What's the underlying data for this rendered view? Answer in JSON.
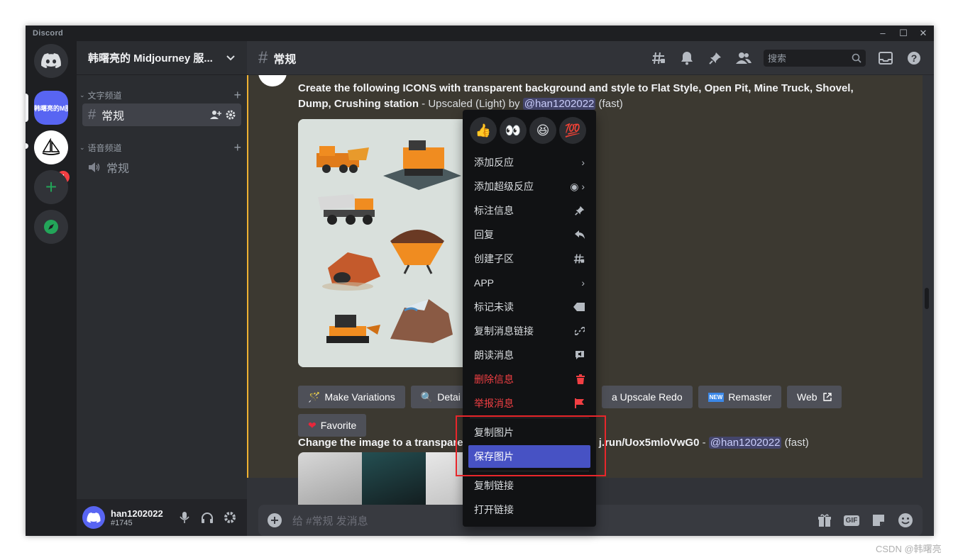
{
  "window": {
    "app_name": "Discord",
    "minimize": "–",
    "maximize": "☐",
    "close": "✕"
  },
  "servers": {
    "home_icon": "discord-logo-icon",
    "active_server_label": "韩曙亮的M服务",
    "midjourney_badge": "1",
    "add_server": "+",
    "explore": "compass-icon"
  },
  "guild": {
    "name": "韩曙亮的 Midjourney 服...",
    "chevron": "⌄"
  },
  "categories": {
    "text": "文字频道",
    "voice": "语音频道"
  },
  "channels": {
    "text_channel": "常规",
    "voice_channel": "常规"
  },
  "user": {
    "name": "han1202022",
    "tag": "#1745"
  },
  "header": {
    "channel_name": "常规",
    "search_placeholder": "搜索"
  },
  "message1": {
    "prompt": "Create the following ICONS with transparent background and style to Flat Style, Open Pit, Mine Truck, Shovel, Dump, Crushing station",
    "suffix": " - Upscaled (Light) by ",
    "mention": "@han1202022",
    "speed": " (fast)"
  },
  "buttons": {
    "make_variations": "Make Variations",
    "detail": "Detai",
    "upscale_redo": "a Upscale Redo",
    "remaster": "Remaster",
    "web": "Web",
    "favorite": "Favorite"
  },
  "message2": {
    "prefix": "Change the image to a transparen",
    "link": "j.run/Uox5mloVwG0",
    "dash": " - ",
    "mention": "@han1202022",
    "speed": " (fast)"
  },
  "composer": {
    "placeholder": "给 #常规 发消息"
  },
  "context_menu": {
    "reactions": [
      "👍",
      "👀",
      "😆",
      "💯"
    ],
    "items": [
      {
        "label": "添加反应",
        "icon": "chevron-right-icon"
      },
      {
        "label": "添加超级反应",
        "icon": "super-reaction-icon"
      },
      {
        "label": "标注信息",
        "icon": "pin-icon"
      },
      {
        "label": "回复",
        "icon": "reply-icon"
      },
      {
        "label": "创建子区",
        "icon": "thread-icon"
      },
      {
        "label": "APP",
        "icon": "chevron-right-icon"
      },
      {
        "label": "标记未读",
        "icon": "mark-unread-icon"
      },
      {
        "label": "复制消息链接",
        "icon": "link-icon"
      },
      {
        "label": "朗读消息",
        "icon": "speak-icon"
      },
      {
        "label": "删除信息",
        "icon": "trash-icon"
      },
      {
        "label": "举报消息",
        "icon": "flag-icon"
      },
      {
        "label": "复制图片",
        "icon": ""
      },
      {
        "label": "保存图片",
        "icon": ""
      },
      {
        "label": "复制链接",
        "icon": ""
      },
      {
        "label": "打开链接",
        "icon": ""
      }
    ]
  },
  "watermark": "CSDN @韩曙亮",
  "colors": {
    "blurple": "#5865f2",
    "danger": "#f23f43",
    "highlight": "#4752c4",
    "annotation_red": "#e8262b",
    "mention_bar": "#f0b232"
  }
}
